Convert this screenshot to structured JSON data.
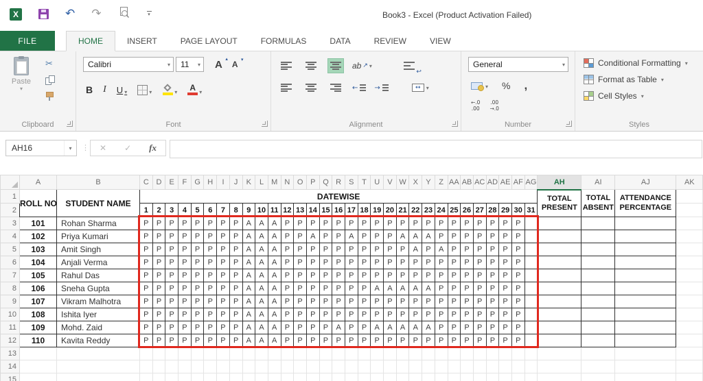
{
  "title_bar": {
    "title": "Book3 - Excel (Product Activation Failed)"
  },
  "tabs": {
    "file": "FILE",
    "items": [
      "HOME",
      "INSERT",
      "PAGE LAYOUT",
      "FORMULAS",
      "DATA",
      "REVIEW",
      "VIEW"
    ],
    "active": "HOME"
  },
  "ribbon": {
    "clipboard": {
      "label": "Clipboard",
      "paste": "Paste"
    },
    "font": {
      "label": "Font",
      "font_name": "Calibri",
      "font_size": "11",
      "bold": "B",
      "italic": "I",
      "underline": "U",
      "grow_font_letter": "A",
      "shrink_font_letter": "A",
      "font_color_letter": "A"
    },
    "alignment": {
      "label": "Alignment",
      "orientation_text": "ab"
    },
    "number": {
      "label": "Number",
      "format": "General",
      "percent": "%",
      "comma": ",",
      "increase_decimal_top": "←.0",
      "increase_decimal_bottom": ".00",
      "decrease_decimal_top": ".00",
      "decrease_decimal_bottom": "→.0"
    },
    "styles": {
      "label": "Styles",
      "conditional_formatting": "Conditional Formatting",
      "format_as_table": "Format as Table",
      "cell_styles": "Cell Styles"
    }
  },
  "formula_bar": {
    "name_box": "AH16"
  },
  "icons": {
    "excel_x": "X",
    "dropdown": "▾",
    "cut": "✂",
    "undo": "↶",
    "redo": "↷",
    "separator_dots": "⋮",
    "cancel": "✕",
    "enter": "✓",
    "fx": "fx",
    "orientation_arrow": "↗",
    "wrap_arrow": "↩",
    "merge_arrow": "↔",
    "outdent_arrow": "←",
    "indent_arrow": "→",
    "grow_caret": "▴",
    "shrink_caret": "▾"
  },
  "grid": {
    "selected_column": "AH",
    "column_letters": [
      "A",
      "B",
      "C",
      "D",
      "E",
      "F",
      "G",
      "H",
      "I",
      "J",
      "K",
      "L",
      "M",
      "N",
      "O",
      "P",
      "Q",
      "R",
      "S",
      "T",
      "U",
      "V",
      "W",
      "X",
      "Y",
      "Z",
      "AA",
      "AB",
      "AC",
      "AD",
      "AE",
      "AF",
      "AG",
      "AH",
      "AI",
      "AJ",
      "AK"
    ],
    "row_numbers": [
      1,
      2,
      3,
      4,
      5,
      6,
      7,
      8,
      9,
      10,
      11,
      12,
      13,
      14,
      15
    ],
    "headers": {
      "roll": "ROLL NO",
      "name": "STUDENT NAME",
      "datewise": "DATEWISE",
      "total_present": "TOTAL PRESENT",
      "total_absent": "TOTAL ABSENT",
      "attendance_percentage": "ATTENDANCE PERCENTAGE"
    },
    "days": [
      1,
      2,
      3,
      4,
      5,
      6,
      7,
      8,
      9,
      10,
      11,
      12,
      13,
      14,
      15,
      16,
      17,
      18,
      19,
      20,
      21,
      22,
      23,
      24,
      25,
      26,
      27,
      28,
      29,
      30,
      31
    ],
    "students": [
      {
        "roll": "101",
        "name": "Rohan Sharma",
        "marks": "PPPPPPPPAAAPPPPPPPPPPPPPPPPPPP"
      },
      {
        "roll": "102",
        "name": "Priya Kumari",
        "marks": "PPPPPPPPAAAPPAPPAPPPAAAPPPPPPP"
      },
      {
        "roll": "103",
        "name": "Amit Singh",
        "marks": "PPPPPPPPAAAPPPPPPPPPPAPAPPPPPP"
      },
      {
        "roll": "104",
        "name": "Anjali Verma",
        "marks": "PPPPPPPPAAAPPPPPPPPPPPPPPPPPPP"
      },
      {
        "roll": "105",
        "name": "Rahul Das",
        "marks": "PPPPPPPPAAAPPPPPPPPPPPPPPPPPPP"
      },
      {
        "roll": "106",
        "name": "Sneha Gupta",
        "marks": "PPPPPPPPAAAPPPPPPPAAAAAPPPPPPP"
      },
      {
        "roll": "107",
        "name": "Vikram Malhotra",
        "marks": "PPPPPPPPAAAPPPPPPPPPPPPPPPPPPP"
      },
      {
        "roll": "108",
        "name": "Ishita Iyer",
        "marks": "PPPPPPPPAAAPPPPPPPPPPPPPPPPPPP"
      },
      {
        "roll": "109",
        "name": "Mohd. Zaid",
        "marks": "PPPPPPPPAAAPPPPAPPAAAAAPPPPPPP"
      },
      {
        "roll": "110",
        "name": "Kavita Reddy",
        "marks": "PPPPPPPPAAAPPPPPPPPPPPPPPPPPPP"
      }
    ]
  },
  "colors": {
    "accent_green": "#217346",
    "red_box": "#e0281e",
    "align_active": "#a5d6b8",
    "fill_yellow": "#ffe400",
    "font_color_red": "#e03c32",
    "save_purple": "#8e44ad"
  }
}
